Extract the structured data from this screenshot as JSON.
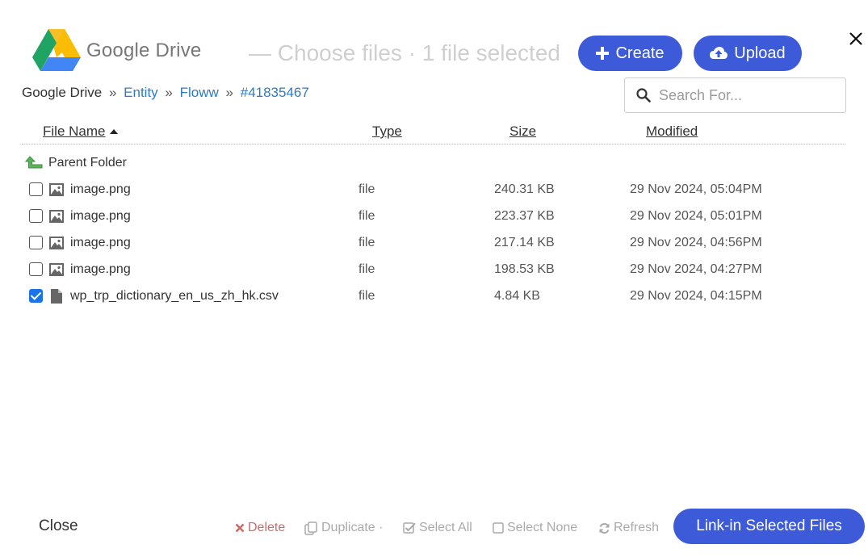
{
  "header": {
    "logo_text": "Google Drive",
    "subtitle": "— Choose files · 1 file selected",
    "create_label": "Create",
    "upload_label": "Upload"
  },
  "breadcrumb": {
    "root": "Google Drive",
    "items": [
      "Entity",
      "Floww",
      "#41835467"
    ],
    "separator": "»"
  },
  "search": {
    "placeholder": "Search For..."
  },
  "columns": {
    "name": "File Name",
    "type": "Type",
    "size": "Size",
    "modified": "Modified"
  },
  "parent_folder_label": "Parent Folder",
  "files": [
    {
      "name": "image.png",
      "type": "file",
      "size": "240.31 KB",
      "modified": "29 Nov 2024, 05:04PM",
      "checked": false,
      "icon": "image-icon"
    },
    {
      "name": "image.png",
      "type": "file",
      "size": "223.37 KB",
      "modified": "29 Nov 2024, 05:01PM",
      "checked": false,
      "icon": "image-icon"
    },
    {
      "name": "image.png",
      "type": "file",
      "size": "217.14 KB",
      "modified": "29 Nov 2024, 04:56PM",
      "checked": false,
      "icon": "image-icon"
    },
    {
      "name": "image.png",
      "type": "file",
      "size": "198.53 KB",
      "modified": "29 Nov 2024, 04:27PM",
      "checked": false,
      "icon": "image-icon"
    },
    {
      "name": "wp_trp_dictionary_en_us_zh_hk.csv",
      "type": "file",
      "size": "4.84 KB",
      "modified": "29 Nov 2024, 04:15PM",
      "checked": true,
      "icon": "document-icon"
    }
  ],
  "footer": {
    "close_label": "Close",
    "delete_label": "Delete",
    "duplicate_label": "Duplicate ·",
    "select_all_label": "Select All",
    "select_none_label": "Select None",
    "refresh_label": "Refresh",
    "link_in_label": "Link-in Selected Files"
  },
  "colors": {
    "accent": "#3d5bd9",
    "link": "#2f7bc2",
    "checkbox": "#1a73e8",
    "delete": "#c96b6b"
  }
}
